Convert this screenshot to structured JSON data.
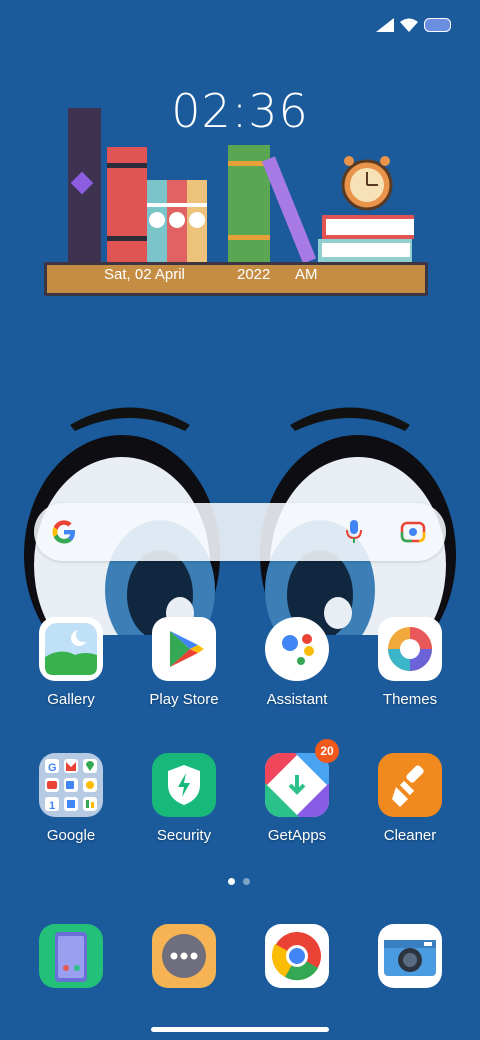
{
  "status_bar": {
    "icons": [
      "signal-icon",
      "wifi-icon",
      "battery-icon"
    ]
  },
  "clock_widget": {
    "time": "02:36",
    "date": "Sat, 02 April",
    "year": "2022",
    "ampm": "AM"
  },
  "search_widget": {
    "icons": [
      "google-logo-icon",
      "microphone-icon",
      "lens-camera-icon"
    ]
  },
  "apps_row1": [
    {
      "label": "Gallery",
      "icon": "gallery-icon"
    },
    {
      "label": "Play Store",
      "icon": "play-store-icon"
    },
    {
      "label": "Assistant",
      "icon": "assistant-icon"
    },
    {
      "label": "Themes",
      "icon": "themes-icon"
    }
  ],
  "apps_row2": [
    {
      "label": "Google",
      "icon": "google-folder-icon"
    },
    {
      "label": "Security",
      "icon": "security-shield-icon"
    },
    {
      "label": "GetApps",
      "icon": "getapps-icon",
      "badge": "20"
    },
    {
      "label": "Cleaner",
      "icon": "cleaner-brush-icon"
    }
  ],
  "page_indicator": {
    "pages": 2,
    "active": 1
  },
  "dock": [
    {
      "icon": "phone-icon"
    },
    {
      "icon": "messages-icon"
    },
    {
      "icon": "chrome-icon"
    },
    {
      "icon": "camera-icon"
    }
  ],
  "colors": {
    "wallpaper": "#1b5b9c",
    "shelf": "#c58d43",
    "badge": "#f0581c"
  }
}
